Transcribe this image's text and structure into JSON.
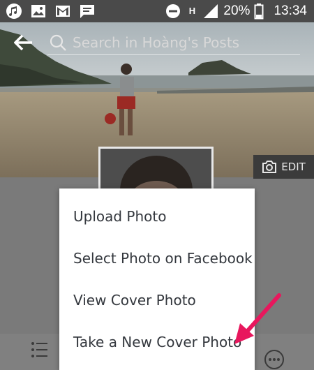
{
  "status_bar": {
    "network": "H",
    "battery": "20%",
    "time": "13:34"
  },
  "search": {
    "placeholder": "Search in Hoàng's Posts"
  },
  "cover": {
    "edit_label": "EDIT"
  },
  "menu": {
    "items": [
      "Upload Photo",
      "Select Photo on Facebook",
      "View Cover Photo",
      "Take a New Cover Photo"
    ]
  },
  "colors": {
    "accent_arrow": "#e8175d",
    "menu_text": "#33373d"
  }
}
